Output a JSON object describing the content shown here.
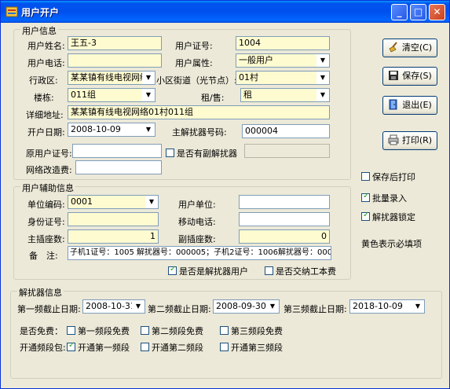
{
  "window": {
    "title": "用户开户",
    "minimize": "_",
    "maximize": "□",
    "close": "✕"
  },
  "user_info": {
    "legend": "用户信息",
    "name_label": "用户姓名:",
    "name_value": "王五-3",
    "cert_label": "用户证号:",
    "cert_value": "1004",
    "phone_label": "用户电话:",
    "phone_value": "",
    "attr_label": "用户属性:",
    "attr_value": "一般用户",
    "district_label": "行政区:",
    "district_value": "某某镇有线电视网络",
    "street_label": "小区街道（光节点）:",
    "street_value": "01村",
    "building_label": "楼栋:",
    "building_value": "011组",
    "rent_label": "租/售:",
    "rent_value": "租",
    "address_label": "详细地址:",
    "address_value": "某某镇有线电视网络01村011组",
    "open_date_label": "开户日期:",
    "open_date_value": "2008-10-09",
    "main_descrambler_label": "主解扰器号码:",
    "main_descrambler_value": "000004",
    "orig_cert_label": "原用户证号:",
    "orig_cert_value": "",
    "has_sub_label": "是否有副解扰器",
    "has_sub_checked": false,
    "sub_value": "",
    "net_fee_label": "网络改造费:",
    "net_fee_value": ""
  },
  "aux_info": {
    "legend": "用户辅助信息",
    "unit_code_label": "单位编码:",
    "unit_code_value": "0001",
    "user_unit_label": "用户单位:",
    "user_unit_value": "",
    "id_label": "身份证号:",
    "id_value": "",
    "mobile_label": "移动电话:",
    "mobile_value": "",
    "main_sockets_label": "主插座数:",
    "main_sockets_value": "1",
    "sub_sockets_label": "副插座数:",
    "sub_sockets_value": "0",
    "remark_label": "备　注:",
    "remark_value": "子机1证号：1005 解扰器号：000005；子机2证号：1006解扰器号：000006",
    "is_descrambler_user_label": "是否是解扰器用户",
    "is_descrambler_user_checked": true,
    "paid_install_label": "是否交纳工本费",
    "paid_install_checked": false
  },
  "descrambler_info": {
    "legend": "解扰器信息",
    "band1_end_label": "第一频截止日期:",
    "band1_end_value": "2008-10-31",
    "band2_end_label": "第二频截止日期:",
    "band2_end_value": "2008-09-30",
    "band3_end_label": "第三频截止日期:",
    "band3_end_value": "2018-10-09",
    "free_label": "是否免费：",
    "free1_label": "第一频段免费",
    "free1_checked": false,
    "free2_label": "第二频段免费",
    "free2_checked": false,
    "free3_label": "第三频段免费",
    "free3_checked": false,
    "open_label": "开通频段包:",
    "open1_label": "开通第一频段",
    "open1_checked": true,
    "open2_label": "开通第二频段",
    "open2_checked": false,
    "open3_label": "开通第三频段",
    "open3_checked": false
  },
  "side": {
    "clear_label": "清空(C)",
    "save_label": "保存(S)",
    "exit_label": "退出(E)",
    "print_label": "打印(R)",
    "print_after_save_label": "保存后打印",
    "print_after_save_checked": false,
    "batch_entry_label": "批量录入",
    "batch_entry_checked": true,
    "lock_descrambler_label": "解扰器锁定",
    "lock_descrambler_checked": true,
    "yellow_note": "黄色表示必填项"
  },
  "colors": {
    "required": "#fffbd0",
    "titlebar": "#0054e3",
    "face": "#ece9d8"
  }
}
